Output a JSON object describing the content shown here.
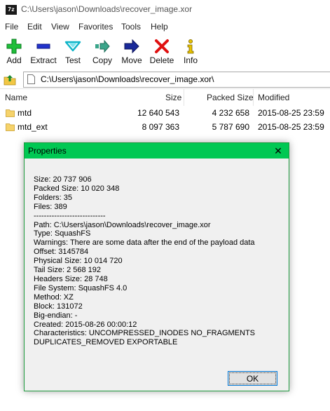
{
  "window": {
    "app_icon_text": "7z",
    "title": "C:\\Users\\jason\\Downloads\\recover_image.xor"
  },
  "menu": [
    "File",
    "Edit",
    "View",
    "Favorites",
    "Tools",
    "Help"
  ],
  "toolbar": {
    "add": "Add",
    "extract": "Extract",
    "test": "Test",
    "copy": "Copy",
    "move": "Move",
    "delete": "Delete",
    "info": "Info"
  },
  "address": {
    "path": "C:\\Users\\jason\\Downloads\\recover_image.xor\\"
  },
  "columns": {
    "name": "Name",
    "size": "Size",
    "packed": "Packed Size",
    "modified": "Modified"
  },
  "rows": [
    {
      "name": "mtd",
      "size": "12 640 543",
      "packed": "4 232 658",
      "modified": "2015-08-25 23:59"
    },
    {
      "name": "mtd_ext",
      "size": "8 097 363",
      "packed": "5 787 690",
      "modified": "2015-08-25 23:59"
    }
  ],
  "colors": {
    "dialog_title_bg": "#00c853",
    "ok_border": "#0078d7"
  },
  "dialog": {
    "title": "Properties",
    "close_icon": "close-icon",
    "lines": [
      "Size: 20 737 906",
      "Packed Size: 10 020 348",
      "Folders: 35",
      "Files: 389",
      "----------------------------",
      "Path: C:\\Users\\jason\\Downloads\\recover_image.xor",
      "Type: SquashFS",
      "Warnings: There are some data after the end of the payload data",
      "Offset: 3145784",
      "Physical Size: 10 014 720",
      "Tail Size: 2 568 192",
      "Headers Size: 28 748",
      "File System: SquashFS 4.0",
      "Method: XZ",
      "Block: 131072",
      "Big-endian: -",
      "Created: 2015-08-26 00:00:12",
      "Characteristics: UNCOMPRESSED_INODES NO_FRAGMENTS",
      "DUPLICATES_REMOVED EXPORTABLE"
    ],
    "ok": "OK"
  }
}
